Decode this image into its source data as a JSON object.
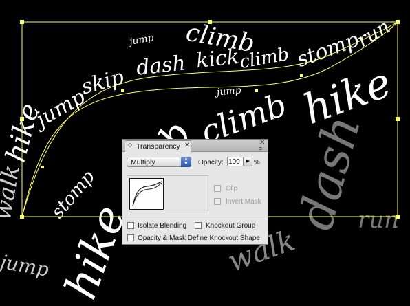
{
  "artwork": {
    "words": [
      "walk",
      "hike",
      "jump",
      "skip",
      "dash",
      "kick",
      "climb",
      "stomp",
      "run",
      "jump",
      "climb",
      "jump",
      "hike",
      "climb",
      "stomp",
      "hike",
      "dash",
      "walk",
      "run",
      "jump",
      "climb"
    ]
  },
  "panel": {
    "tab_label": "Transparency",
    "toggle_icon": "◇",
    "close_icon": "✕",
    "menu_icon": "≡",
    "blend_mode": "Multiply",
    "opacity_label": "Opacity:",
    "opacity_value": "100",
    "opacity_stepper_icon": "▶",
    "opacity_unit": "%",
    "clip_label": "Clip",
    "invert_mask_label": "Invert Mask",
    "isolate_blending_label": "Isolate Blending",
    "knockout_group_label": "Knockout Group",
    "opacity_mask_label": "Opacity & Mask Define Knockout Shape"
  }
}
